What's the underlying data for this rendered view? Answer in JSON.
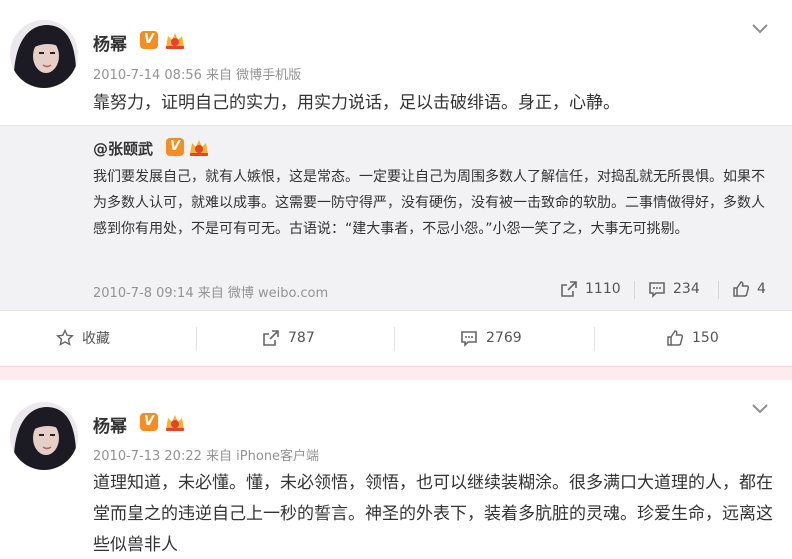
{
  "posts": [
    {
      "username": "杨幂",
      "verified_badge": "V",
      "time": "2010-7-14 08:56",
      "source_prefix": "来自",
      "source": "微博手机版",
      "text": "靠努力，证明自己的实力，用实力说话，足以击破绯语。身正，心静。",
      "repost": {
        "username": "@张颐武",
        "verified_badge": "V",
        "text": "我们要发展自己，就有人嫉恨，这是常态。一定要让自己为周围多数人了解信任，对捣乱就无所畏惧。如果不为多数人认可，就难以成事。这需要一防守得严，没有硬伤，没有被一击致命的软肋。二事情做得好，多数人感到你有用处，不是可有可无。古语说：“建大事者，不忌小怨。”小怨一笑了之，大事无可挑剔。",
        "time": "2010-7-8 09:14",
        "source_prefix": "来自",
        "source": "微博 weibo.com",
        "forward_count": "1110",
        "comment_count": "234",
        "like_count": "4"
      },
      "actions": {
        "favorite_label": "收藏",
        "forward_count": "787",
        "comment_count": "2769",
        "like_count": "150"
      }
    },
    {
      "username": "杨幂",
      "verified_badge": "V",
      "time": "2010-7-13 20:22",
      "source_prefix": "来自",
      "source": "iPhone客户端",
      "text": "道理知道，未必懂。懂，未必领悟，领悟，也可以继续装糊涂。很多满口大道理的人，都在堂而皇之的违逆自己上一秒的誓言。神圣的外表下，装着多肮脏的灵魂。珍爱生命，远离这些似兽非人"
    }
  ],
  "icons": {
    "menu": "chevron-down-icon",
    "verified": "verified-v-icon",
    "member": "crown-icon",
    "favorite": "star-icon",
    "forward": "share-arrow-icon",
    "comment": "comment-icon",
    "like": "thumbs-up-icon"
  },
  "colors": {
    "verified": "#f78c1f",
    "member_crown": "#e8412c",
    "meta_text": "#939393",
    "repost_bg": "#f2f2f5",
    "separator_band": "#fcecef"
  }
}
